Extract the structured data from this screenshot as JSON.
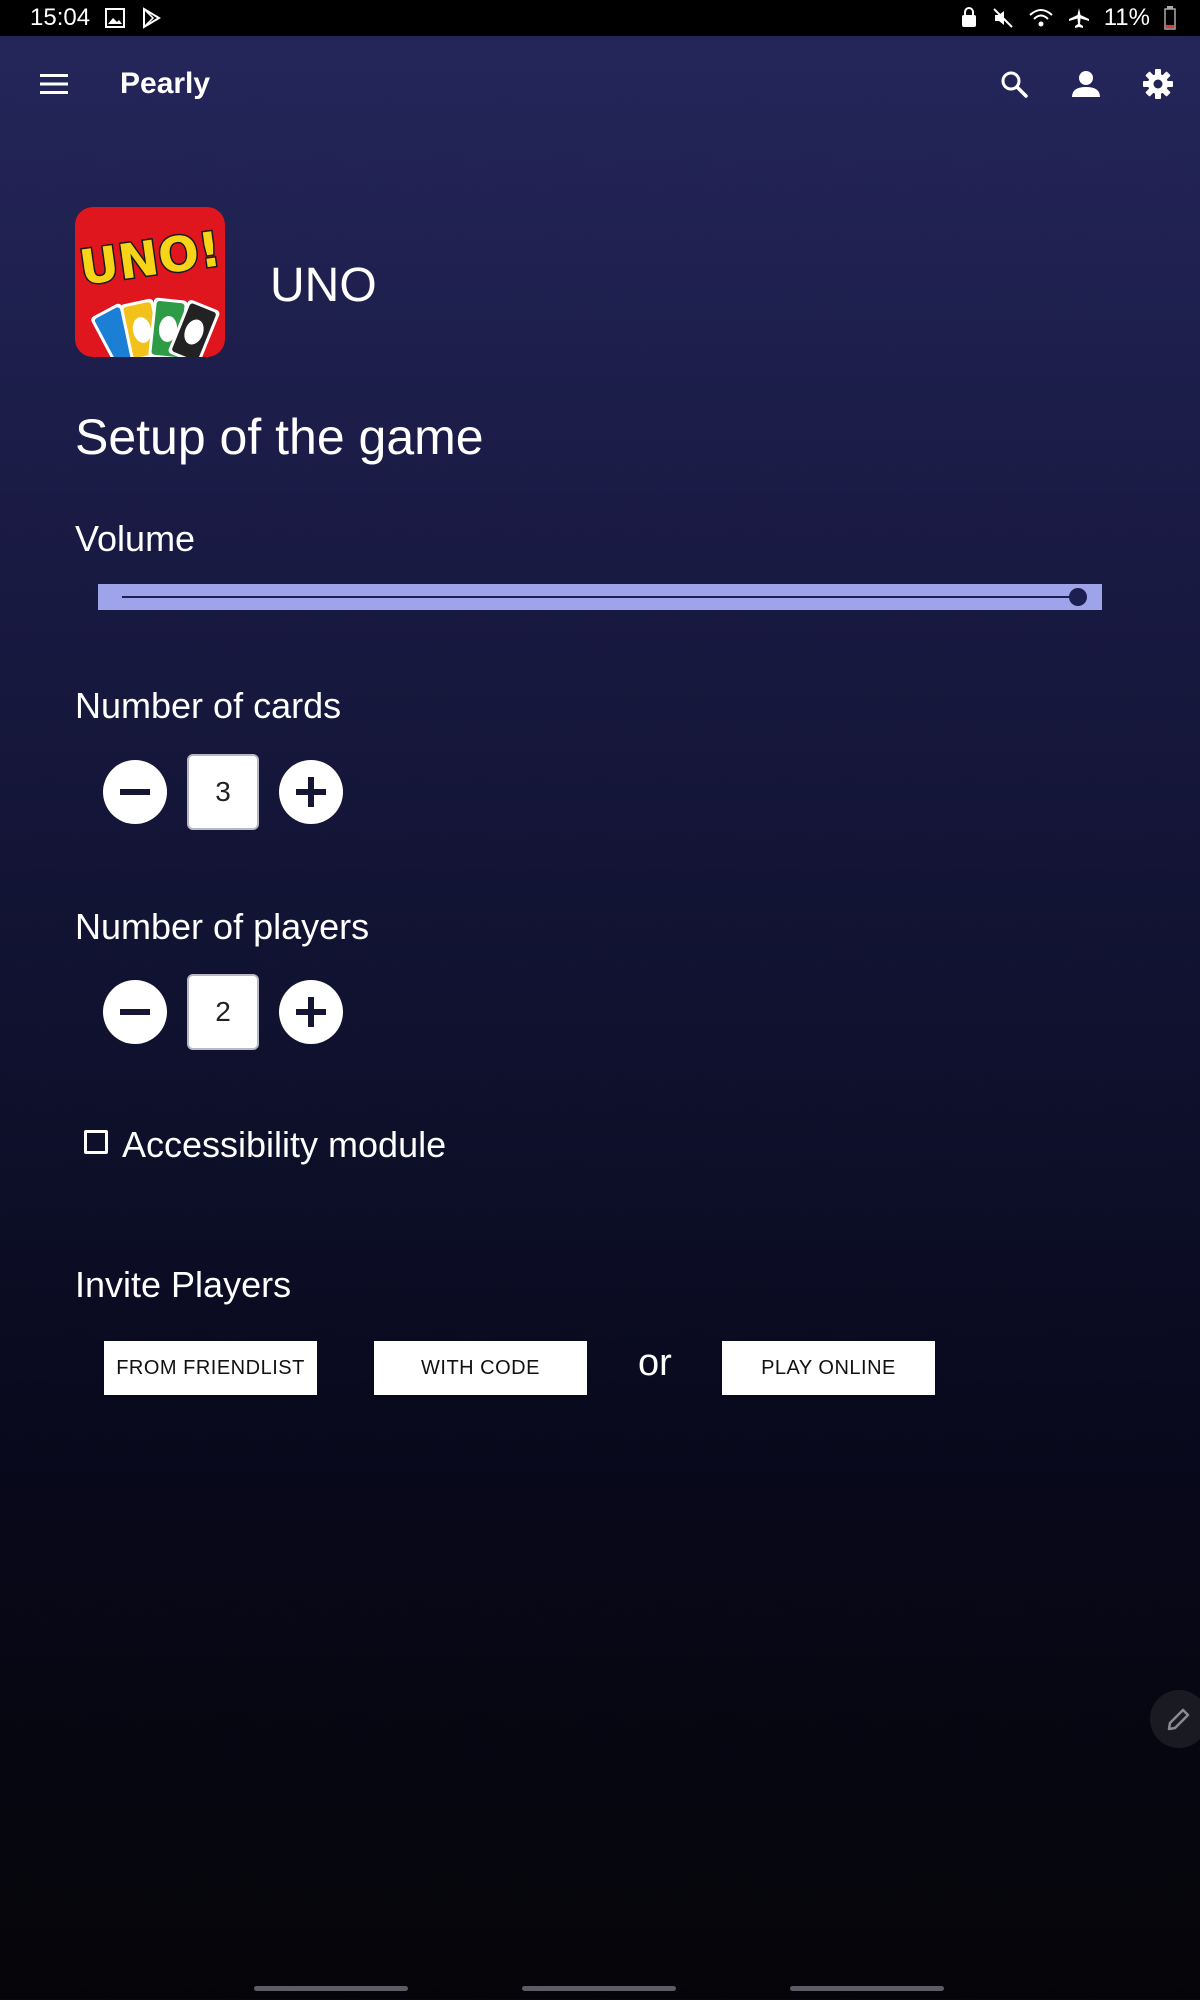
{
  "status_bar": {
    "time": "15:04",
    "battery": "11%",
    "icons_left": [
      "image-icon",
      "play-store-icon"
    ],
    "icons_right": [
      "lock-icon",
      "mute-icon",
      "wifi-icon",
      "airplane-icon",
      "battery-icon"
    ]
  },
  "app_bar": {
    "title": "Pearly",
    "icons": [
      "menu-icon",
      "search-icon",
      "account-icon",
      "settings-icon"
    ]
  },
  "game": {
    "title": "UNO",
    "logo_text": "UNO!"
  },
  "setup": {
    "heading": "Setup of the game",
    "volume": {
      "label": "Volume",
      "value": 1.0
    },
    "cards": {
      "label": "Number of cards",
      "value": "3"
    },
    "players": {
      "label": "Number of players",
      "value": "2"
    },
    "accessibility": {
      "label": "Accessibility module",
      "checked": false
    }
  },
  "invite": {
    "heading": "Invite Players",
    "friendlist_label": "FROM FRIENDLIST",
    "code_label": "WITH CODE",
    "or_label": "or",
    "online_label": "PLAY ONLINE"
  },
  "colors": {
    "background_top": "#25275c",
    "background_bottom": "#050509",
    "slider_bg": "#9fa3ea",
    "slider_fg": "#1d1f52"
  }
}
